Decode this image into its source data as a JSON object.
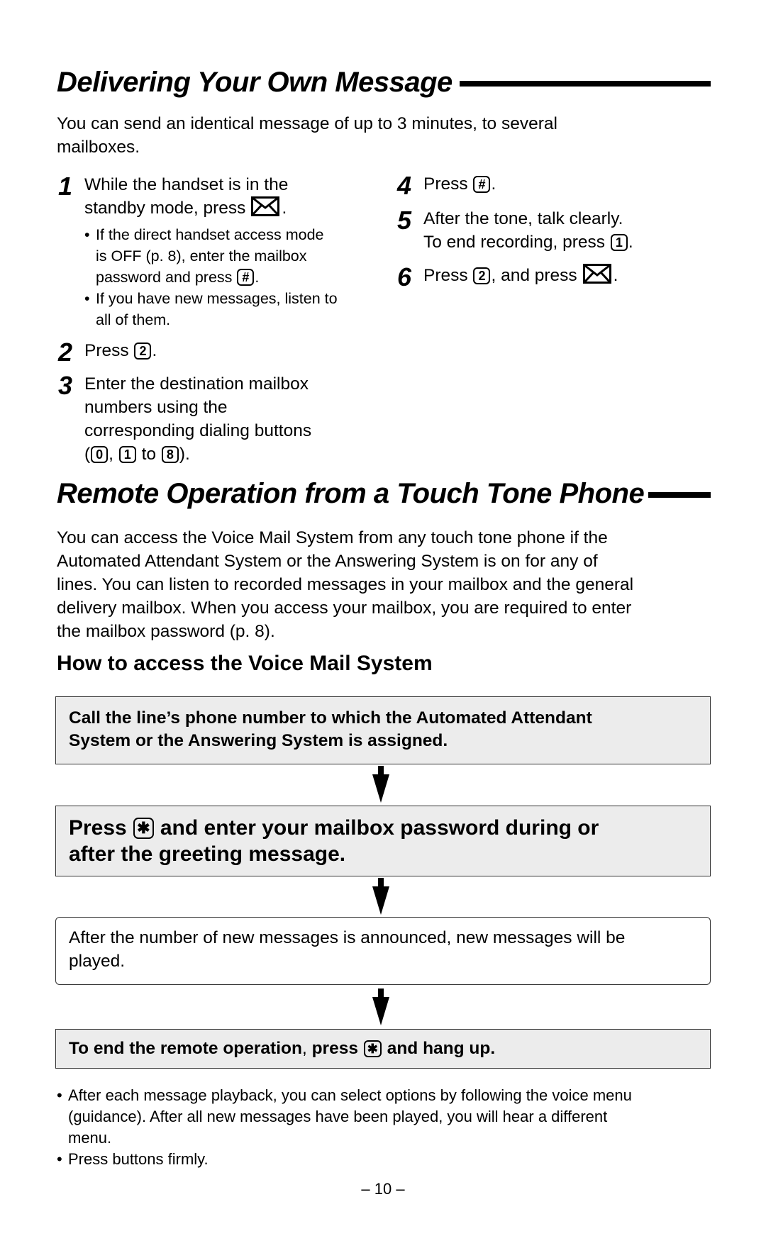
{
  "section1": {
    "title": "Delivering Your Own Message",
    "intro_line1": "You can send an identical message of up to 3 minutes, to several",
    "intro_line2": "mailboxes.",
    "steps": [
      {
        "number": "1",
        "line1": "While the handset is in the",
        "line2_pre": "standby mode, press",
        "line2_key": "mail-icon",
        "line2_post": ".",
        "bullets": [
          {
            "line1": "If the direct handset access mode",
            "line2": "is OFF (p. 8), enter the mailbox",
            "line3_pre": "password and press",
            "key": "#",
            "line3_post": "."
          },
          {
            "line1": "If you have new messages, listen to",
            "line2": "all of them."
          }
        ]
      },
      {
        "number": "2",
        "pre": "Press",
        "key": "2",
        "post": "."
      },
      {
        "number": "3",
        "line1": "Enter the destination mailbox",
        "line2": "numbers using the",
        "line3": "corresponding dialing buttons",
        "line4_open": "(",
        "key_a": "0",
        "sep": ",",
        "key_b": "1",
        "to": "to",
        "key_c": "8",
        "line4_close": ")."
      },
      {
        "number": "4",
        "pre": "Press",
        "key": "#",
        "post": "."
      },
      {
        "number": "5",
        "line1": "After the tone, talk clearly.",
        "line2_pre": "To end recording, press",
        "key": "1",
        "line2_post": "."
      },
      {
        "number": "6",
        "pre": "Press",
        "key": "2",
        "mid": ", and press",
        "icon": "mail-icon",
        "post": "."
      }
    ]
  },
  "section2": {
    "title": "Remote Operation from a Touch Tone Phone",
    "intro_lines": [
      "You can access the Voice Mail System from any touch tone phone if the",
      "Automated Attendant System or the Answering System is on for any of",
      "lines. You can listen to recorded messages in your mailbox and the general",
      "delivery mailbox. When you access your mailbox, you are required to enter",
      "the mailbox password (p. 8)."
    ],
    "subheading": "How to access the Voice Mail System",
    "flow": [
      {
        "line1": "Call the line’s phone number to which the Automated Attendant",
        "line2": "System or the Answering System is assigned."
      },
      {
        "pre": "Press",
        "key": "✱",
        "line1_post": "and enter your mailbox password during or",
        "line2": "after the greeting message."
      },
      {
        "line1": "After the number of new messages is announced, new messages will be",
        "line2": "played."
      },
      {
        "pre": "To end the remote operation",
        "comma": ",",
        "mid": "press",
        "key": "✱",
        "post": "and hang up."
      }
    ],
    "notes": [
      {
        "line1": "After each message playback, you can select options by following the voice menu",
        "line2": "(guidance). After all new messages have been played, you will hear a different",
        "line3": "menu."
      },
      {
        "line1": "Press buttons firmly."
      }
    ]
  },
  "page_number": "– 10 –"
}
